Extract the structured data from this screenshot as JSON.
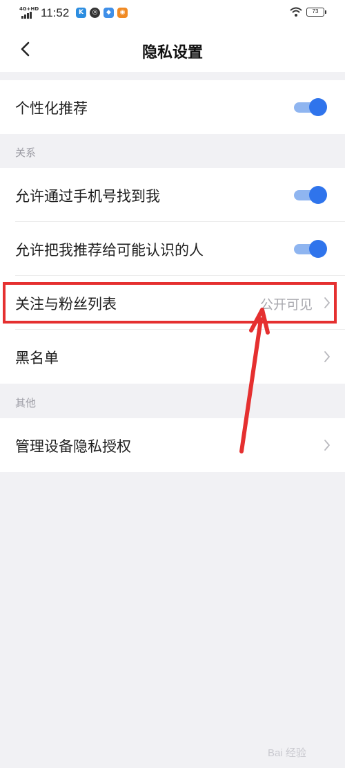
{
  "status_bar": {
    "network": "4G+HD",
    "time": "11:52",
    "apps": [
      {
        "icon": "k-app-icon",
        "letter": "K",
        "color": "#2c8de0"
      },
      {
        "icon": "compass-app-icon",
        "letter": "◎",
        "color": "#333333"
      },
      {
        "icon": "cloud-app-icon",
        "letter": "◆",
        "color": "#3f8fe8"
      },
      {
        "icon": "game-app-icon",
        "letter": "◉",
        "color": "#f08a24"
      }
    ],
    "battery": "73"
  },
  "nav": {
    "title": "隐私设置"
  },
  "groups": {
    "personal": {
      "rows": [
        {
          "label": "个性化推荐",
          "toggle": true
        }
      ]
    },
    "relations": {
      "section_label": "关系",
      "rows": [
        {
          "label": "允许通过手机号找到我",
          "toggle": true
        },
        {
          "label": "允许把我推荐给可能认识的人",
          "toggle": true
        },
        {
          "label": "关注与粉丝列表",
          "value": "公开可见"
        },
        {
          "label": "黑名单"
        }
      ]
    },
    "other": {
      "section_label": "其他",
      "rows": [
        {
          "label": "管理设备隐私授权"
        }
      ]
    }
  },
  "colors": {
    "toggle_on": "#2f74ec",
    "annotation": "#e53030"
  },
  "watermark": "Bai 经验"
}
